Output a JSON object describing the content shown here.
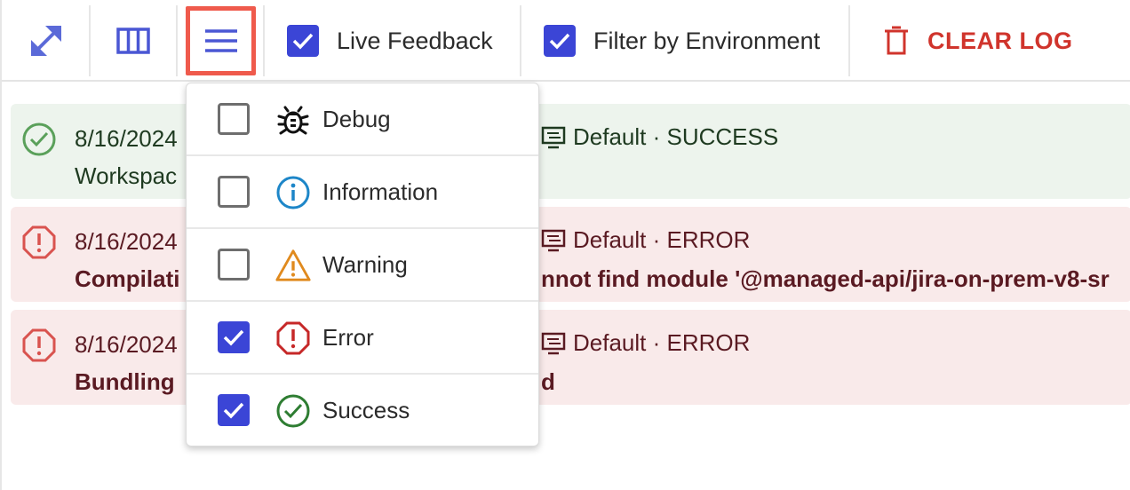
{
  "toolbar": {
    "expand_icon": "diagonal-arrows-icon",
    "columns_icon": "columns-icon",
    "menu_icon": "hamburger-menu-icon",
    "live_feedback": {
      "label": "Live Feedback",
      "checked": true
    },
    "filter_env": {
      "label": "Filter by Environment",
      "checked": true
    },
    "clear_log": {
      "label": "CLEAR LOG",
      "icon": "trash-icon"
    }
  },
  "colors": {
    "accent": "#3b45d6",
    "danger": "#d0342c",
    "success_bg": "#edf4ed",
    "error_bg": "#f9eaea",
    "highlight": "#ef5a4c"
  },
  "logs": [
    {
      "level": "success",
      "timestamp": "8/16/2024",
      "environment": "Default · SUCCESS",
      "message": "Workspac",
      "message_right": ""
    },
    {
      "level": "error",
      "timestamp": "8/16/2024",
      "environment": "Default · ERROR",
      "message": "Compilati",
      "message_right": "nnot find module '@managed-api/jira-on-prem-v8-sr"
    },
    {
      "level": "error",
      "timestamp": "8/16/2024",
      "environment": "Default · ERROR",
      "message": "Bundling",
      "message_right": "d"
    }
  ],
  "level_filter": {
    "items": [
      {
        "label": "Debug",
        "icon": "bug-icon",
        "checked": false
      },
      {
        "label": "Information",
        "icon": "info-icon",
        "checked": false
      },
      {
        "label": "Warning",
        "icon": "warning-icon",
        "checked": false
      },
      {
        "label": "Error",
        "icon": "error-octagon-icon",
        "checked": true
      },
      {
        "label": "Success",
        "icon": "check-circle-icon",
        "checked": true
      }
    ]
  }
}
